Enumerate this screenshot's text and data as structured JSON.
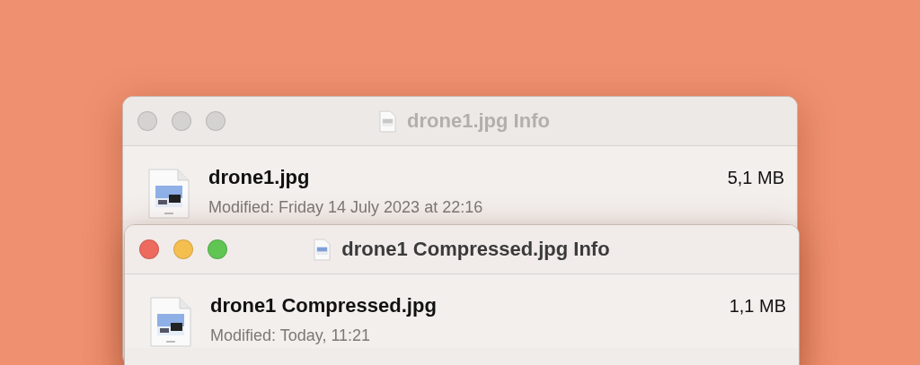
{
  "windows": [
    {
      "title": "drone1.jpg Info",
      "active": false,
      "file": {
        "name": "drone1.jpg",
        "size": "5,1 MB",
        "modified": "Modified: Friday 14 July 2023 at 22:16"
      }
    },
    {
      "title": "drone1 Compressed.jpg Info",
      "active": true,
      "file": {
        "name": "drone1 Compressed.jpg",
        "size": "1,1 MB",
        "modified": "Modified: Today, 11:21"
      }
    }
  ]
}
